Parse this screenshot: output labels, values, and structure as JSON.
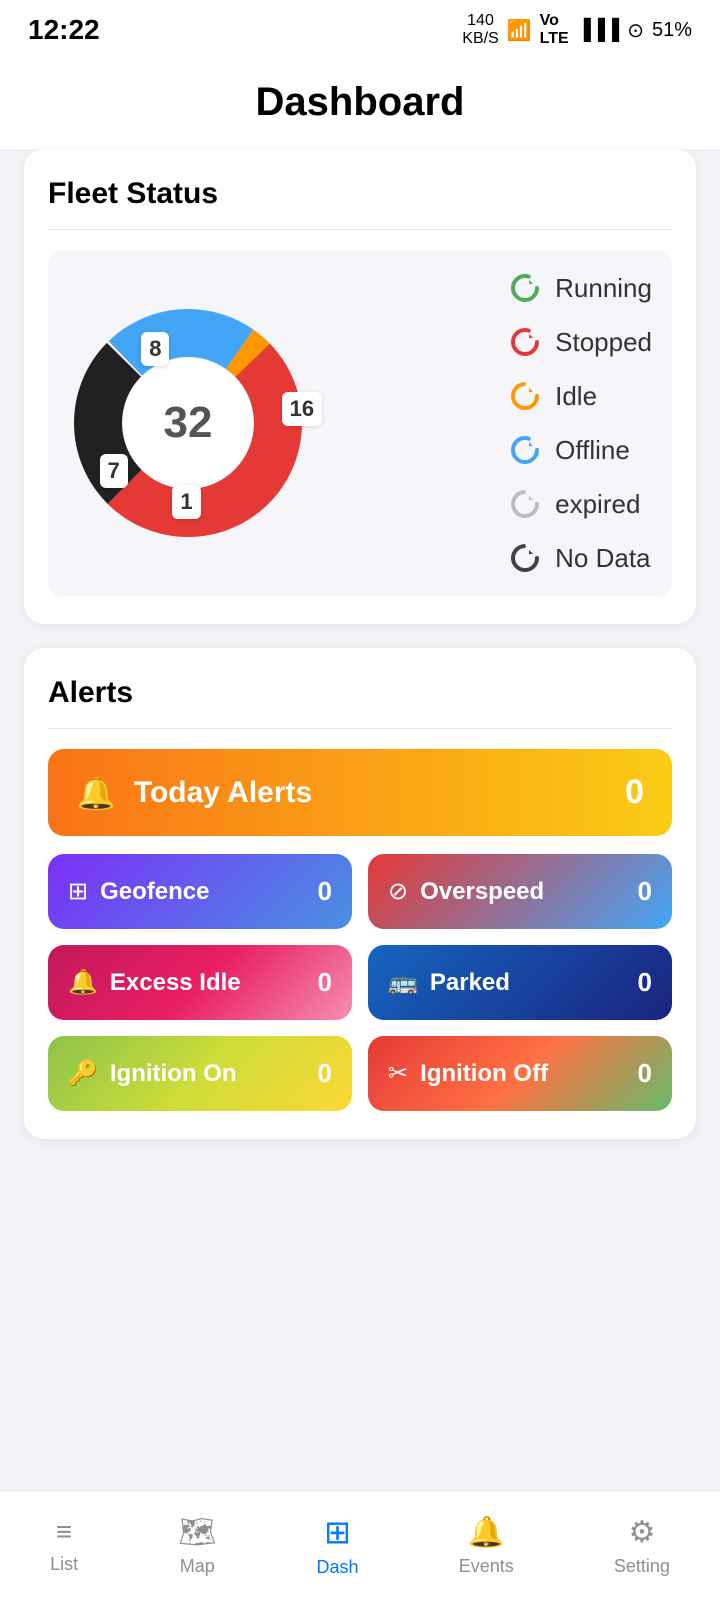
{
  "statusBar": {
    "time": "12:22",
    "data": "140\nKB/S",
    "battery": "51%"
  },
  "header": {
    "title": "Dashboard"
  },
  "fleetStatus": {
    "title": "Fleet Status",
    "total": "32",
    "segments": [
      {
        "label": "16",
        "color": "#e53935",
        "percent": 50,
        "posTop": "36%",
        "posLeft": "88%"
      },
      {
        "label": "8",
        "color": "#212121",
        "percent": 25,
        "posTop": "15%",
        "posLeft": "38%"
      },
      {
        "label": "7",
        "color": "#42a5f5",
        "percent": 22,
        "posTop": "62%",
        "posLeft": "22%"
      },
      {
        "label": "1",
        "color": "#ff9800",
        "percent": 3,
        "posTop": "74%",
        "posLeft": "48%"
      }
    ],
    "legend": [
      {
        "label": "Running",
        "color": "#4caf50",
        "id": "running"
      },
      {
        "label": "Stopped",
        "color": "#e53935",
        "id": "stopped"
      },
      {
        "label": "Idle",
        "color": "#ff9800",
        "id": "idle"
      },
      {
        "label": "Offline",
        "color": "#42a5f5",
        "id": "offline"
      },
      {
        "label": "expired",
        "color": "#bdbdbd",
        "id": "expired"
      },
      {
        "label": "No Data",
        "color": "#424242",
        "id": "nodata"
      }
    ]
  },
  "alerts": {
    "title": "Alerts",
    "todayAlerts": {
      "label": "Today Alerts",
      "count": "0",
      "icon": "🔔"
    },
    "items": [
      {
        "id": "geofence",
        "label": "Geofence",
        "count": "0",
        "icon": "⊞",
        "gradient": "linear-gradient(135deg, #7b2ff7, #4a90e2)"
      },
      {
        "id": "overspeed",
        "label": "Overspeed",
        "count": "0",
        "icon": "⊘",
        "gradient": "linear-gradient(135deg, #e53935, #42a5f5)"
      },
      {
        "id": "excess-idle",
        "label": "Excess Idle",
        "count": "0",
        "icon": "🔔",
        "gradient": "linear-gradient(135deg, #c2185b, #e91e63, #ec407a, #ef9a9a)"
      },
      {
        "id": "parked",
        "label": "Parked",
        "count": "0",
        "icon": "🚌",
        "gradient": "linear-gradient(135deg, #1565c0, #1a237e)"
      },
      {
        "id": "ignition-on",
        "label": "Ignition On",
        "count": "0",
        "icon": "🔑",
        "gradient": "linear-gradient(135deg, #8bc34a, #cddc39, #fdd835)"
      },
      {
        "id": "ignition-off",
        "label": "Ignition Off",
        "count": "0",
        "icon": "✂",
        "gradient": "linear-gradient(135deg, #e53935, #ff7043, #66bb6a)"
      }
    ]
  },
  "bottomNav": {
    "items": [
      {
        "id": "list",
        "label": "List",
        "icon": "≡",
        "active": false
      },
      {
        "id": "map",
        "label": "Map",
        "icon": "🗺",
        "active": false
      },
      {
        "id": "dash",
        "label": "Dash",
        "icon": "⊞",
        "active": true
      },
      {
        "id": "events",
        "label": "Events",
        "icon": "🔔",
        "active": false
      },
      {
        "id": "setting",
        "label": "Setting",
        "icon": "⚙",
        "active": false
      }
    ]
  }
}
